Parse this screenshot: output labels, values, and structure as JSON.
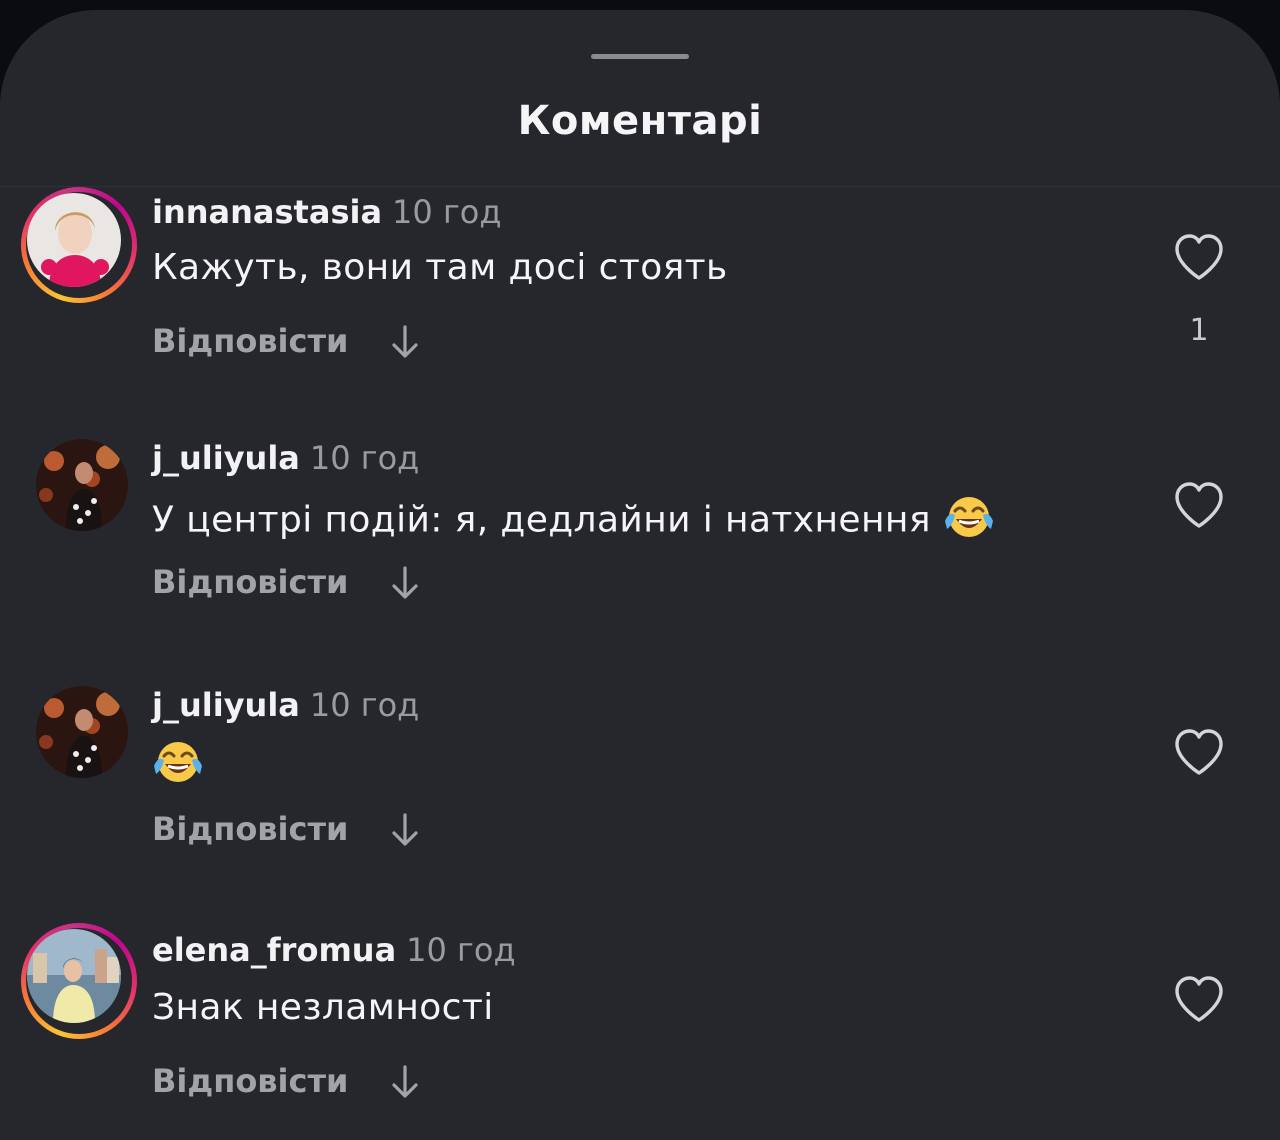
{
  "sheet": {
    "title": "Коментарі"
  },
  "icons": {
    "like": "heart-outline-icon",
    "expand_replies": "arrow-down-icon",
    "emoji": "face-with-tears-of-joy-emoji"
  },
  "colors": {
    "background": "#26272c",
    "story_ring_start": "#f9c437",
    "story_ring_end": "#c13584",
    "secondary_text": "#9a9ba1"
  },
  "comments": [
    {
      "username": "innanastasia",
      "time": "10 год",
      "text": "Кажуть, вони там досі стоять",
      "emoji": "",
      "reply_label": "Відповісти",
      "likes": "1",
      "has_story_ring": true
    },
    {
      "username": "j_uliyula",
      "time": "10 год",
      "text": "У центрі подій: я, дедлайни і натхнення",
      "emoji": "😂",
      "reply_label": "Відповісти",
      "likes": "",
      "has_story_ring": false
    },
    {
      "username": "j_uliyula",
      "time": "10 год",
      "text": "",
      "emoji": "😂",
      "reply_label": "Відповісти",
      "likes": "",
      "has_story_ring": false
    },
    {
      "username": "elena_fromua",
      "time": "10 год",
      "text": "Знак незламності",
      "emoji": "",
      "reply_label": "Відповісти",
      "likes": "",
      "has_story_ring": true
    }
  ]
}
